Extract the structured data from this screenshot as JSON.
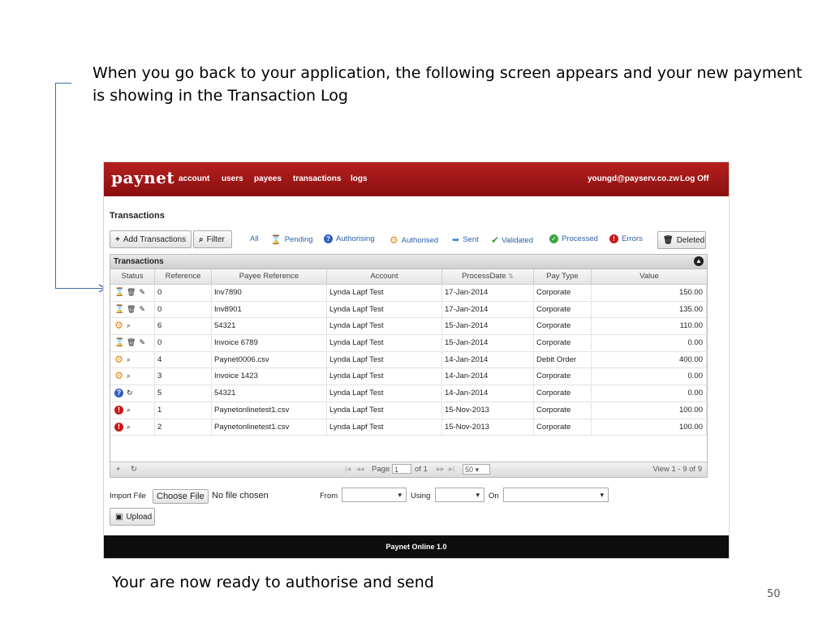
{
  "slide": {
    "intro": "When you go back to your application, the following screen appears and your new payment is showing in the Transaction Log",
    "outro": "Your are now ready to authorise and send",
    "page_number": "50"
  },
  "app": {
    "logo": "paynet",
    "nav": [
      "account",
      "users",
      "payees",
      "transactions",
      "logs"
    ],
    "user_email": "youngd@payserv.co.zw",
    "logoff": "Log Off",
    "page_title": "Transactions",
    "buttons": {
      "add": "Add Transactions",
      "filter": "Filter",
      "deleted": "Deleted",
      "upload": "Upload",
      "choose_file": "Choose File"
    },
    "filters": {
      "all": "All",
      "pending": "Pending",
      "authorising": "Authorising",
      "authorised": "Authorised",
      "sent": "Sent",
      "validated": "Validated",
      "processed": "Processed",
      "errors": "Errors"
    },
    "grid": {
      "caption": "Transactions",
      "columns": [
        "Status",
        "Reference",
        "Payee Reference",
        "Account",
        "ProcessDate",
        "Pay Type",
        "Value"
      ],
      "rows": [
        {
          "status": "pending",
          "reference": "0",
          "payee_reference": "Inv7890",
          "account": "Lynda Lapf Test",
          "process_date": "17-Jan-2014",
          "pay_type": "Corporate",
          "value": "150.00"
        },
        {
          "status": "pending",
          "reference": "0",
          "payee_reference": "Inv8901",
          "account": "Lynda Lapf Test",
          "process_date": "17-Jan-2014",
          "pay_type": "Corporate",
          "value": "135.00"
        },
        {
          "status": "authorised",
          "reference": "6",
          "payee_reference": "54321",
          "account": "Lynda Lapf Test",
          "process_date": "15-Jan-2014",
          "pay_type": "Corporate",
          "value": "110.00"
        },
        {
          "status": "pending",
          "reference": "0",
          "payee_reference": "Invoice 6789",
          "account": "Lynda Lapf Test",
          "process_date": "15-Jan-2014",
          "pay_type": "Corporate",
          "value": "0.00"
        },
        {
          "status": "authorised",
          "reference": "4",
          "payee_reference": "Paynet0006.csv",
          "account": "Lynda Lapf Test",
          "process_date": "14-Jan-2014",
          "pay_type": "Debit Order",
          "value": "400.00"
        },
        {
          "status": "authorised",
          "reference": "3",
          "payee_reference": "Invoice 1423",
          "account": "Lynda Lapf Test",
          "process_date": "14-Jan-2014",
          "pay_type": "Corporate",
          "value": "0.00"
        },
        {
          "status": "authorising",
          "reference": "5",
          "payee_reference": "54321",
          "account": "Lynda Lapf Test",
          "process_date": "14-Jan-2014",
          "pay_type": "Corporate",
          "value": "0.00"
        },
        {
          "status": "error",
          "reference": "1",
          "payee_reference": "Paynetonlinetest1.csv",
          "account": "Lynda Lapf Test",
          "process_date": "15-Nov-2013",
          "pay_type": "Corporate",
          "value": "100.00"
        },
        {
          "status": "error",
          "reference": "2",
          "payee_reference": "Paynetonlinetest1.csv",
          "account": "Lynda Lapf Test",
          "process_date": "15-Nov-2013",
          "pay_type": "Corporate",
          "value": "100.00"
        }
      ]
    },
    "pager": {
      "page_label": "Page",
      "page": "1",
      "of": "of 1",
      "page_size": "50",
      "view": "View 1 - 9 of 9"
    },
    "import": {
      "label": "Import File",
      "no_file": "No file chosen",
      "from": "From",
      "using": "Using",
      "on": "On"
    },
    "footer": "Paynet Online 1.0",
    "colors": {
      "topbar": "#9e1616",
      "link": "#2a5fa8",
      "authorising": "#2e5fbf",
      "authorised": "#e08a10",
      "sent": "#3a8ad8",
      "validated": "#3ca43c",
      "processed": "#3ca43c",
      "errors": "#c81818",
      "connector": "#3d6cb5"
    }
  }
}
